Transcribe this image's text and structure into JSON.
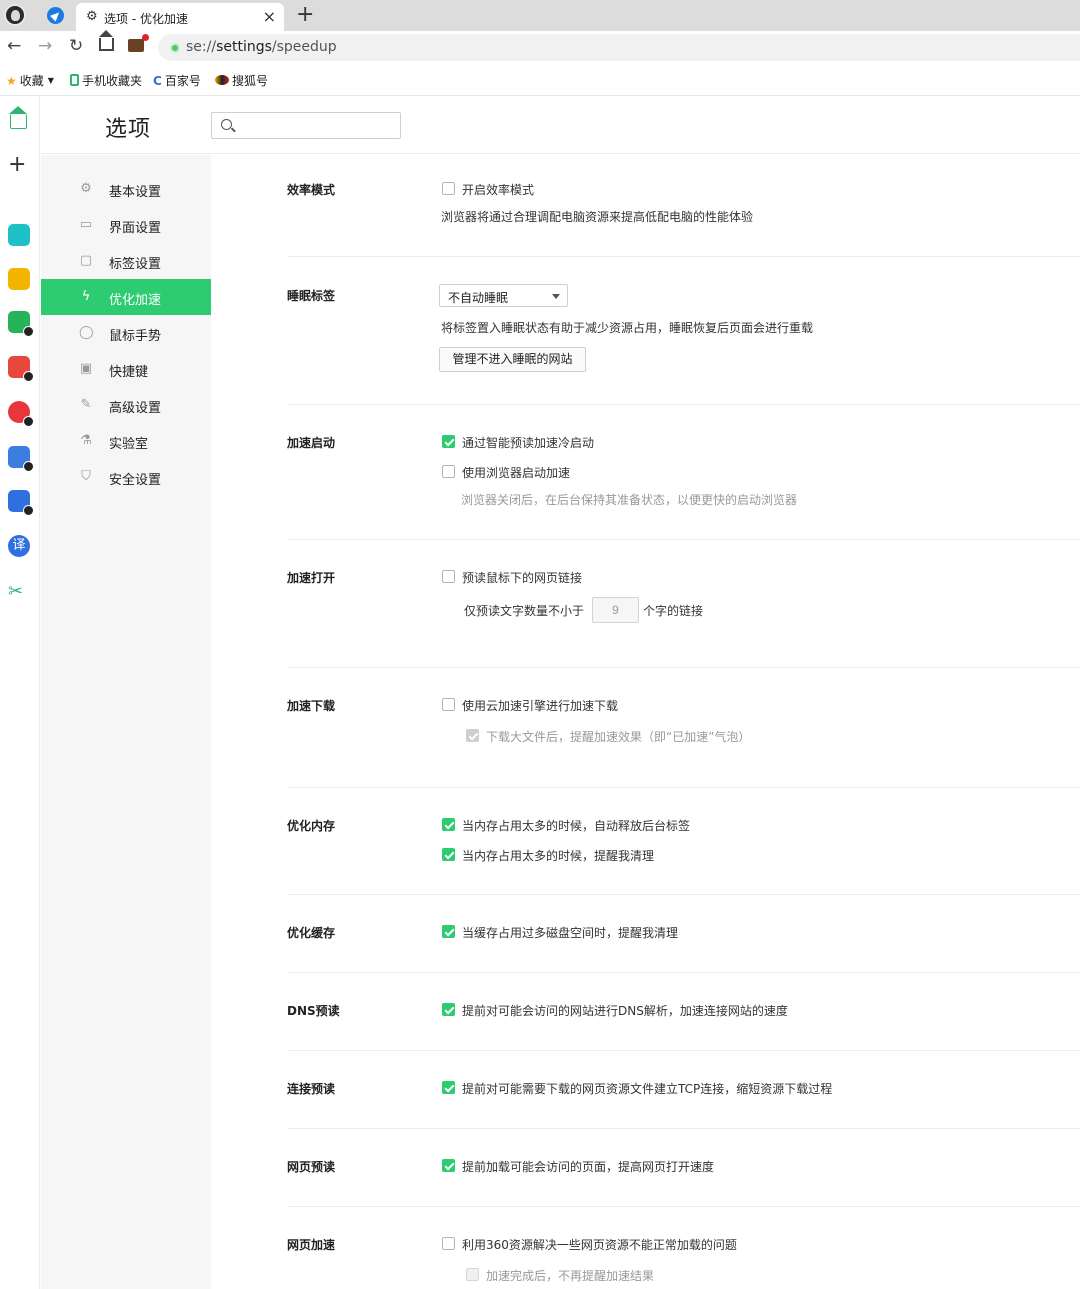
{
  "browser": {
    "tab_title": "选项 - 优化加速",
    "url_prefix": "se://",
    "url_path": "settings",
    "url_suffix": "/speedup",
    "bookmarks": [
      "收藏",
      "手机收藏夹",
      "百家号",
      "搜狐号"
    ]
  },
  "rail": {
    "icons": [
      "home-icon",
      "plus-icon",
      "green-cross-app-icon",
      "star-app-icon",
      "image-ai-icon",
      "pdf-ai-icon",
      "video-ai-icon",
      "edit-ai-icon",
      "doc-ai-icon",
      "translate-icon",
      "scissors-icon"
    ],
    "translate_glyph": "译"
  },
  "header": {
    "title": "选项",
    "search_placeholder": ""
  },
  "sidebar": {
    "items": [
      {
        "label": "基本设置",
        "icon": "gear-icon",
        "active": false
      },
      {
        "label": "界面设置",
        "icon": "window-icon",
        "active": false
      },
      {
        "label": "标签设置",
        "icon": "tab-icon",
        "active": false
      },
      {
        "label": "优化加速",
        "icon": "lightning-icon",
        "active": true
      },
      {
        "label": "鼠标手势",
        "icon": "mouse-icon",
        "active": false
      },
      {
        "label": "快捷键",
        "icon": "keyboard-icon",
        "active": false
      },
      {
        "label": "高级设置",
        "icon": "wrench-icon",
        "active": false
      },
      {
        "label": "实验室",
        "icon": "flask-icon",
        "active": false
      },
      {
        "label": "安全设置",
        "icon": "shield-icon",
        "active": false
      }
    ]
  },
  "sections": {
    "efficiency": {
      "title": "效率模式",
      "option": {
        "label": "开启效率模式",
        "checked": false
      },
      "desc": "浏览器将通过合理调配电脑资源来提高低配电脑的性能体验"
    },
    "sleep": {
      "title": "睡眠标签",
      "select_value": "不自动睡眠",
      "desc": "将标签置入睡眠状态有助于减少资源占用，睡眠恢复后页面会进行重载",
      "button": "管理不进入睡眠的网站"
    },
    "startup": {
      "title": "加速启动",
      "opt1": {
        "label": "通过智能预读加速冷启动",
        "checked": true
      },
      "opt2": {
        "label": "使用浏览器启动加速",
        "checked": false
      },
      "hint": "浏览器关闭后，在后台保持其准备状态，以便更快的启动浏览器"
    },
    "open": {
      "title": "加速打开",
      "opt1": {
        "label": "预读鼠标下的网页链接",
        "checked": false
      },
      "prefix": "仅预读文字数量不小于",
      "count": "9",
      "suffix": "个字的链接"
    },
    "download": {
      "title": "加速下载",
      "opt1": {
        "label": "使用云加速引擎进行加速下载",
        "checked": false
      },
      "opt2": {
        "label": "下载大文件后，提醒加速效果（即“已加速”气泡）",
        "checked": true,
        "disabled": true
      }
    },
    "memory": {
      "title": "优化内存",
      "opt1": {
        "label": "当内存占用太多的时候，自动释放后台标签",
        "checked": true
      },
      "opt2": {
        "label": "当内存占用太多的时候，提醒我清理",
        "checked": true
      }
    },
    "cache": {
      "title": "优化缓存",
      "opt1": {
        "label": "当缓存占用过多磁盘空间时，提醒我清理",
        "checked": true
      }
    },
    "dns": {
      "title": "DNS预读",
      "opt1": {
        "label": "提前对可能会访问的网站进行DNS解析，加速连接网站的速度",
        "checked": true
      }
    },
    "connect": {
      "title": "连接预读",
      "opt1": {
        "label": "提前对可能需要下载的网页资源文件建立TCP连接，缩短资源下载过程",
        "checked": true
      }
    },
    "prefetch": {
      "title": "网页预读",
      "opt1": {
        "label": "提前加载可能会访问的页面，提高网页打开速度",
        "checked": true
      }
    },
    "webspeed": {
      "title": "网页加速",
      "opt1": {
        "label": "利用360资源解决一些网页资源不能正常加载的问题",
        "checked": false
      },
      "opt2": {
        "label": "加速完成后，不再提醒加速结果",
        "checked": false,
        "disabled": true
      }
    }
  },
  "colors": {
    "accent": "#2ecc71",
    "divider": "#ececec",
    "sidebar_bg": "#f6f6f6"
  }
}
